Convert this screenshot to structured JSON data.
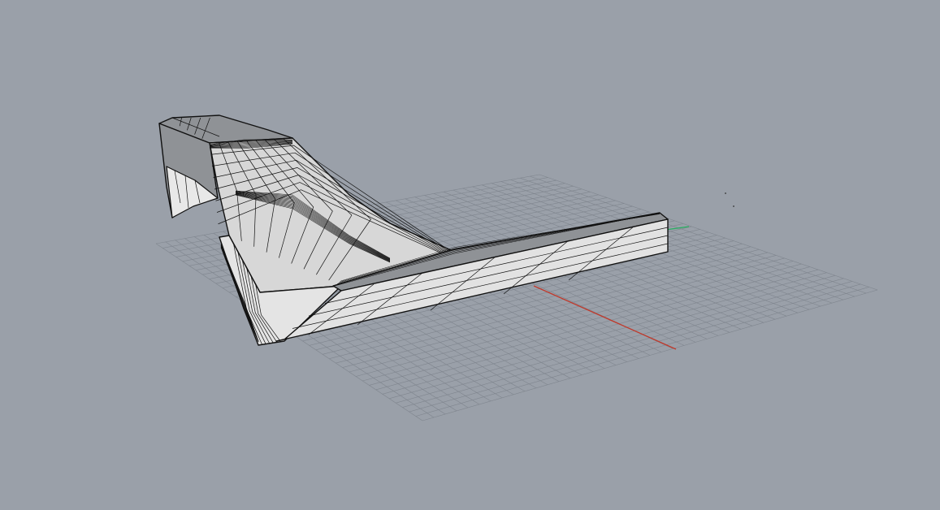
{
  "viewport": {
    "label": "",
    "background_color": "#9aa0a9",
    "grid_color": "#7f858e",
    "grid_visible": true,
    "x_axis_color": "#c0392b",
    "y_axis_color": "#27ae60",
    "model": {
      "description": "",
      "shade_top": "#8f9296",
      "shade_side": "#e6e6e6",
      "shade_mid": "#c8c8c8",
      "edge_color": "#111111"
    }
  }
}
